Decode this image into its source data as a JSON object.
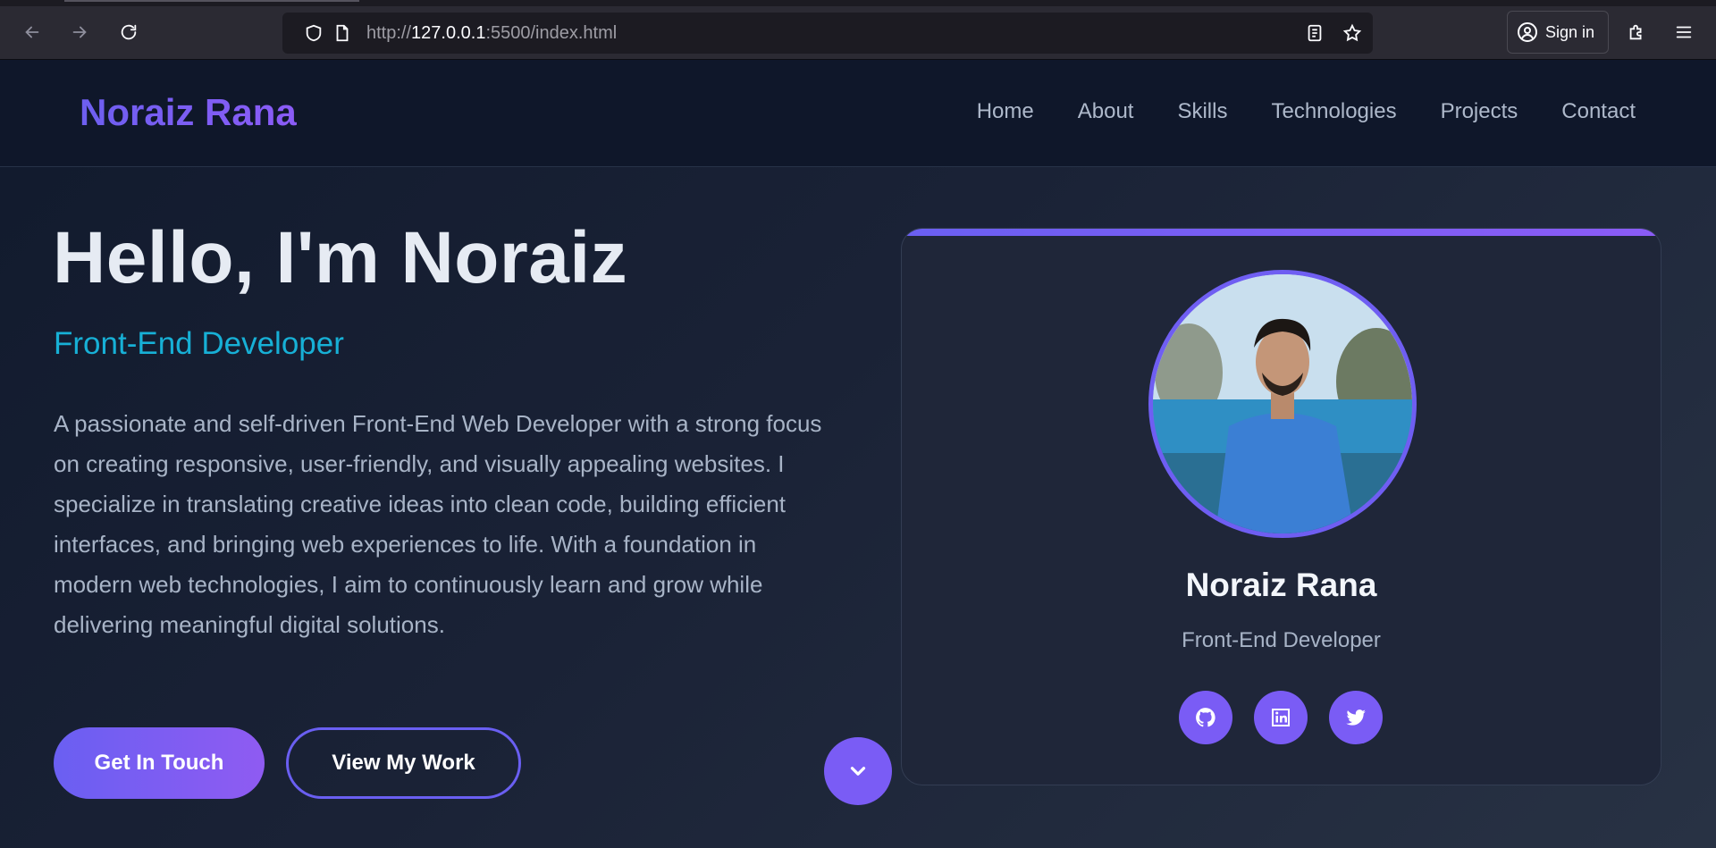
{
  "browser": {
    "url_host": "http://",
    "url_domain": "127.0.0.1",
    "url_rest": ":5500/index.html",
    "signin_label": "Sign in"
  },
  "site": {
    "logo": "Noraiz Rana",
    "nav": [
      "Home",
      "About",
      "Skills",
      "Technologies",
      "Projects",
      "Contact"
    ]
  },
  "hero": {
    "title": "Hello, I'm Noraiz",
    "subtitle": "Front-End Developer",
    "description": "A passionate and self-driven Front-End Web Developer with a strong focus on creating responsive, user-friendly, and visually appealing websites. I specialize in translating creative ideas into clean code, building efficient interfaces, and bringing web experiences to life. With a foundation in modern web technologies, I aim to continuously learn and grow while delivering meaningful digital solutions.",
    "primary_button": "Get In Touch",
    "secondary_button": "View My Work"
  },
  "profile_card": {
    "name": "Noraiz Rana",
    "role": "Front-End Developer",
    "socials": [
      "github-icon",
      "linkedin-icon",
      "twitter-icon"
    ]
  },
  "colors": {
    "accent": "#6d5ff0",
    "accent_secondary": "#8b5cf6",
    "cyan": "#17b0d6",
    "bg": "#1b2233"
  }
}
